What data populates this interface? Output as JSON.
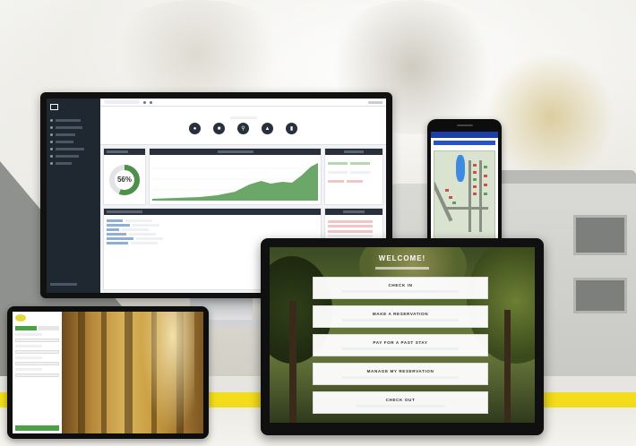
{
  "laptop_kiosk": {
    "welcome": "WELCOME!",
    "buttons": [
      {
        "title": "CHECK IN"
      },
      {
        "title": "MAKE A RESERVATION"
      },
      {
        "title": "PAY FOR A PAST STAY"
      },
      {
        "title": "MANAGE MY RESERVATION"
      },
      {
        "title": "CHECK OUT"
      }
    ]
  },
  "monitor_dashboard": {
    "donut_percent": "56%"
  },
  "colors": {
    "accent_yellow": "#f3dc1a",
    "dashboard_dark": "#28313b",
    "phone_blue": "#1b3fa6",
    "tablet_green": "#49a343"
  }
}
